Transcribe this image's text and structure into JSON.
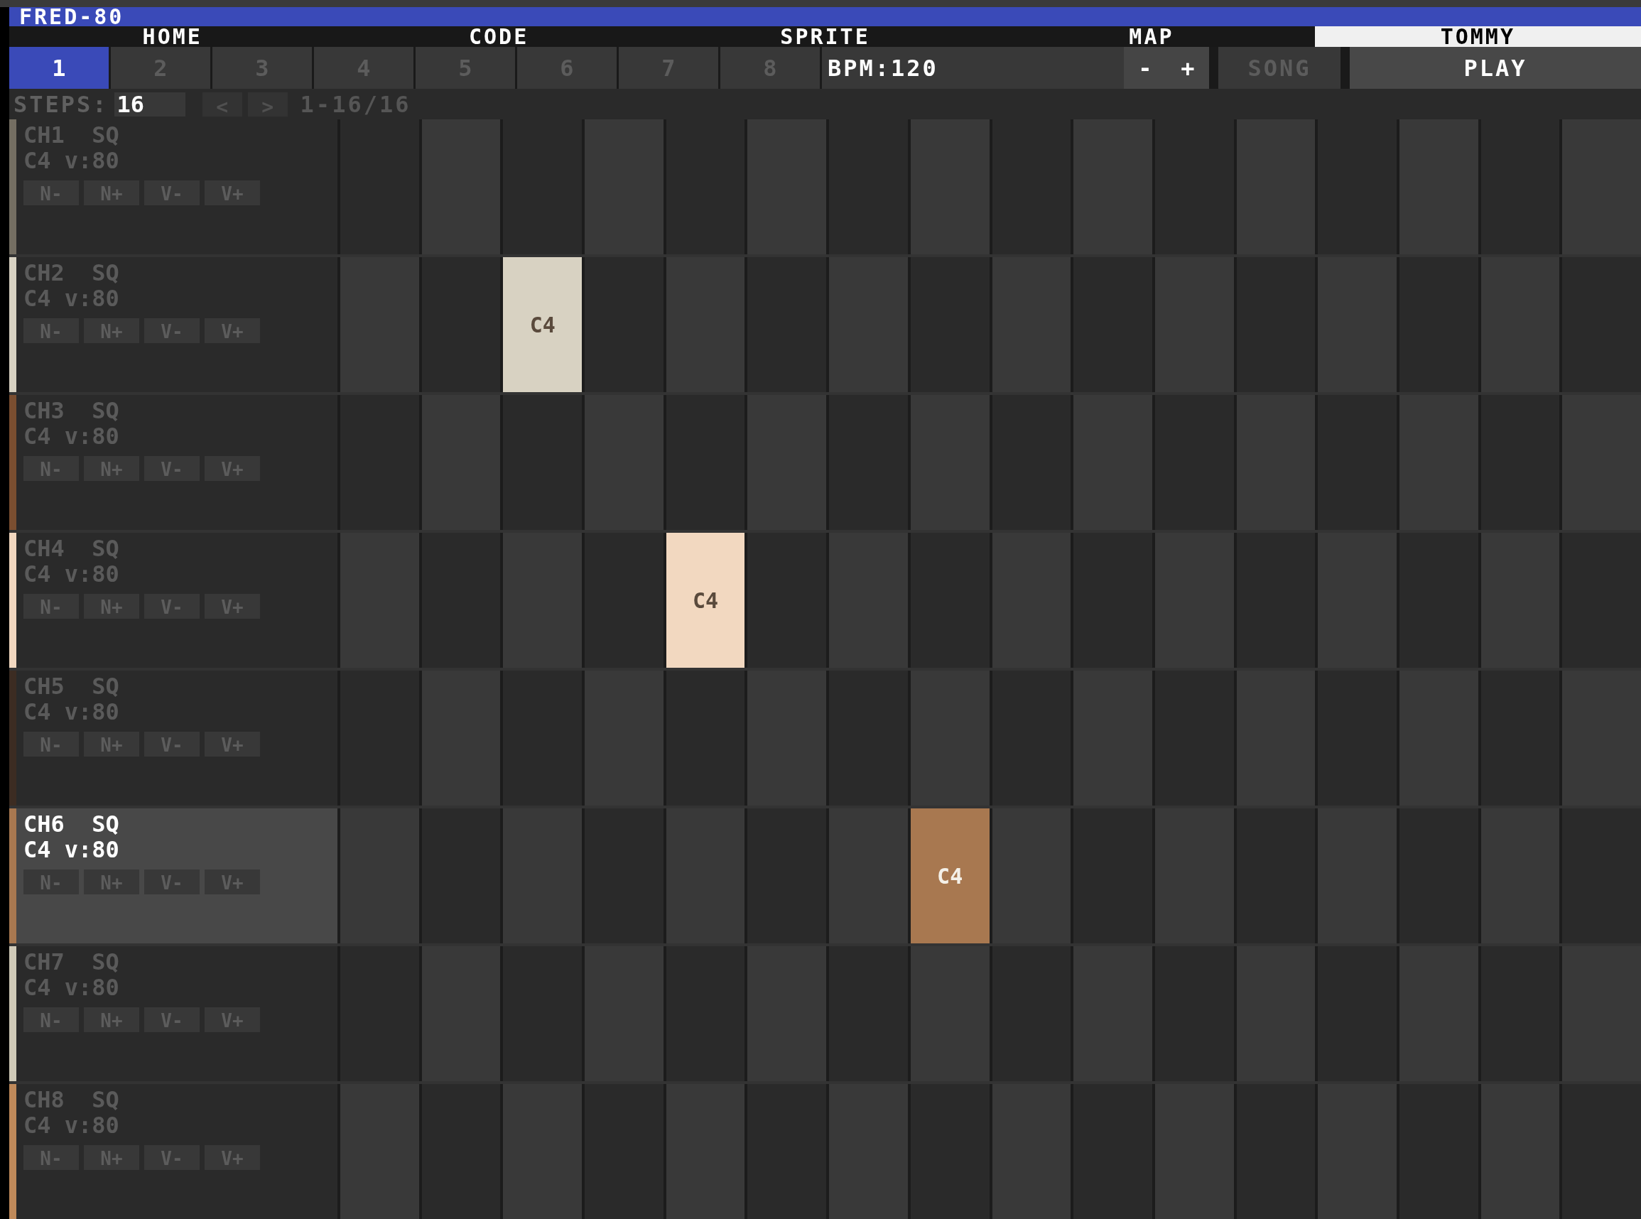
{
  "app": {
    "title": "FRED-80"
  },
  "tabs": [
    {
      "label": "HOME",
      "selected": false
    },
    {
      "label": "CODE",
      "selected": false
    },
    {
      "label": "SPRITE",
      "selected": false
    },
    {
      "label": "MAP",
      "selected": false
    },
    {
      "label": "TOMMY",
      "selected": true
    }
  ],
  "patterns": [
    {
      "label": "1",
      "selected": true
    },
    {
      "label": "2",
      "selected": false
    },
    {
      "label": "3",
      "selected": false
    },
    {
      "label": "4",
      "selected": false
    },
    {
      "label": "5",
      "selected": false
    },
    {
      "label": "6",
      "selected": false
    },
    {
      "label": "7",
      "selected": false
    },
    {
      "label": "8",
      "selected": false
    }
  ],
  "bpm": {
    "label": "BPM:120",
    "buttons": [
      "-",
      "+"
    ]
  },
  "song_button": {
    "label": "SONG",
    "active": false
  },
  "play_button": {
    "label": "PLAY"
  },
  "steps": {
    "label": "STEPS:",
    "value": "16",
    "prev": "<",
    "next": ">",
    "range": "1-16/16"
  },
  "channels": [
    {
      "name": "CH1  SQ",
      "params": "C4 v:80",
      "color": "#746e62",
      "selected": false,
      "buttons": [
        "N-",
        "N+",
        "V-",
        "V+"
      ],
      "cells": [
        {
          "on": false
        },
        {
          "on": false
        },
        {
          "on": false
        },
        {
          "on": false
        },
        {
          "on": false
        },
        {
          "on": false
        },
        {
          "on": false
        },
        {
          "on": false
        },
        {
          "on": false
        },
        {
          "on": false
        },
        {
          "on": false
        },
        {
          "on": false
        },
        {
          "on": false
        },
        {
          "on": false
        },
        {
          "on": false
        },
        {
          "on": false
        }
      ]
    },
    {
      "name": "CH2  SQ",
      "params": "C4 v:80",
      "color": "#d8d2c2",
      "selected": false,
      "buttons": [
        "N-",
        "N+",
        "V-",
        "V+"
      ],
      "cells": [
        {
          "on": false
        },
        {
          "on": false
        },
        {
          "on": true,
          "note": "C4"
        },
        {
          "on": false
        },
        {
          "on": false
        },
        {
          "on": false
        },
        {
          "on": false
        },
        {
          "on": false
        },
        {
          "on": false
        },
        {
          "on": false
        },
        {
          "on": false
        },
        {
          "on": false
        },
        {
          "on": false
        },
        {
          "on": false
        },
        {
          "on": false
        },
        {
          "on": false
        }
      ]
    },
    {
      "name": "CH3  SQ",
      "params": "C4 v:80",
      "color": "#7a4e30",
      "selected": false,
      "buttons": [
        "N-",
        "N+",
        "V-",
        "V+"
      ],
      "cells": [
        {
          "on": false
        },
        {
          "on": false
        },
        {
          "on": false
        },
        {
          "on": false
        },
        {
          "on": false
        },
        {
          "on": false
        },
        {
          "on": false
        },
        {
          "on": false
        },
        {
          "on": false
        },
        {
          "on": false
        },
        {
          "on": false
        },
        {
          "on": false
        },
        {
          "on": false
        },
        {
          "on": false
        },
        {
          "on": false
        },
        {
          "on": false
        }
      ]
    },
    {
      "name": "CH4  SQ",
      "params": "C4 v:80",
      "color": "#f2d8c0",
      "selected": false,
      "buttons": [
        "N-",
        "N+",
        "V-",
        "V+"
      ],
      "cells": [
        {
          "on": false
        },
        {
          "on": false
        },
        {
          "on": false
        },
        {
          "on": false
        },
        {
          "on": true,
          "note": "C4"
        },
        {
          "on": false
        },
        {
          "on": false
        },
        {
          "on": false
        },
        {
          "on": false
        },
        {
          "on": false
        },
        {
          "on": false
        },
        {
          "on": false
        },
        {
          "on": false
        },
        {
          "on": false
        },
        {
          "on": false
        },
        {
          "on": false
        }
      ]
    },
    {
      "name": "CH5  SQ",
      "params": "C4 v:80",
      "color": "#3c2c22",
      "selected": false,
      "buttons": [
        "N-",
        "N+",
        "V-",
        "V+"
      ],
      "cells": [
        {
          "on": false
        },
        {
          "on": false
        },
        {
          "on": false
        },
        {
          "on": false
        },
        {
          "on": false
        },
        {
          "on": false
        },
        {
          "on": false
        },
        {
          "on": false
        },
        {
          "on": false
        },
        {
          "on": false
        },
        {
          "on": false
        },
        {
          "on": false
        },
        {
          "on": false
        },
        {
          "on": false
        },
        {
          "on": false
        },
        {
          "on": false
        }
      ]
    },
    {
      "name": "CH6  SQ",
      "params": "C4 v:80",
      "color": "#a87850",
      "selected": true,
      "buttons": [
        "N-",
        "N+",
        "V-",
        "V+"
      ],
      "cells": [
        {
          "on": false
        },
        {
          "on": false
        },
        {
          "on": false
        },
        {
          "on": false
        },
        {
          "on": false
        },
        {
          "on": false
        },
        {
          "on": false
        },
        {
          "on": true,
          "note": "C4"
        },
        {
          "on": false
        },
        {
          "on": false
        },
        {
          "on": false
        },
        {
          "on": false
        },
        {
          "on": false
        },
        {
          "on": false
        },
        {
          "on": false
        },
        {
          "on": false
        }
      ]
    },
    {
      "name": "CH7  SQ",
      "params": "C4 v:80",
      "color": "#d0cab8",
      "selected": false,
      "buttons": [
        "N-",
        "N+",
        "V-",
        "V+"
      ],
      "cells": [
        {
          "on": false
        },
        {
          "on": false
        },
        {
          "on": false
        },
        {
          "on": false
        },
        {
          "on": false
        },
        {
          "on": false
        },
        {
          "on": false
        },
        {
          "on": false
        },
        {
          "on": false
        },
        {
          "on": false
        },
        {
          "on": false
        },
        {
          "on": false
        },
        {
          "on": false
        },
        {
          "on": false
        },
        {
          "on": false
        },
        {
          "on": false
        }
      ]
    },
    {
      "name": "CH8  SQ",
      "params": "C4 v:80",
      "color": "#c08a5a",
      "selected": false,
      "buttons": [
        "N-",
        "N+",
        "V-",
        "V+"
      ],
      "cells": [
        {
          "on": false
        },
        {
          "on": false
        },
        {
          "on": false
        },
        {
          "on": false
        },
        {
          "on": false
        },
        {
          "on": false
        },
        {
          "on": false
        },
        {
          "on": false
        },
        {
          "on": false
        },
        {
          "on": false
        },
        {
          "on": false
        },
        {
          "on": false
        },
        {
          "on": false
        },
        {
          "on": false
        },
        {
          "on": false
        },
        {
          "on": false
        }
      ]
    }
  ]
}
